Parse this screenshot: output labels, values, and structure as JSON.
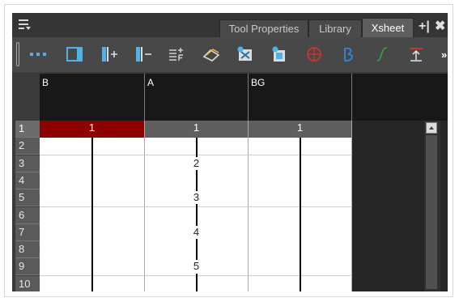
{
  "tabs": [
    {
      "label": "Tool Properties",
      "active": false
    },
    {
      "label": "Library",
      "active": false
    },
    {
      "label": "Xsheet",
      "active": true
    }
  ],
  "tab_controls": {
    "add": "+|",
    "close": "✖"
  },
  "toolbar": {
    "buttons": [
      "show-hide-columns-icon",
      "toggle-timeline-icon",
      "add-columns-icon",
      "remove-columns-icon",
      "add-frames-icon",
      "onion-skin-icon",
      "drawing-substitution-icon",
      "create-drawing-icon",
      "peg-icon",
      "bezier-icon",
      "ease-icon",
      "import-icon"
    ],
    "overflow": "»"
  },
  "columns": [
    {
      "header": "B",
      "cells": {
        "1": "1"
      },
      "selected_first": true
    },
    {
      "header": "A",
      "cells": {
        "1": "1",
        "3": "2",
        "5": "3",
        "7": "4",
        "9": "5"
      },
      "selected_first": false
    },
    {
      "header": "BG",
      "cells": {
        "1": "1"
      },
      "selected_first": false
    }
  ],
  "rows": [
    "1",
    "2",
    "3",
    "4",
    "5",
    "6",
    "7",
    "8",
    "9",
    "10"
  ],
  "current_frame": "1",
  "colors": {
    "selected_cell": "#8e0000",
    "panel": "#3a3a3a",
    "header": "#181818"
  }
}
